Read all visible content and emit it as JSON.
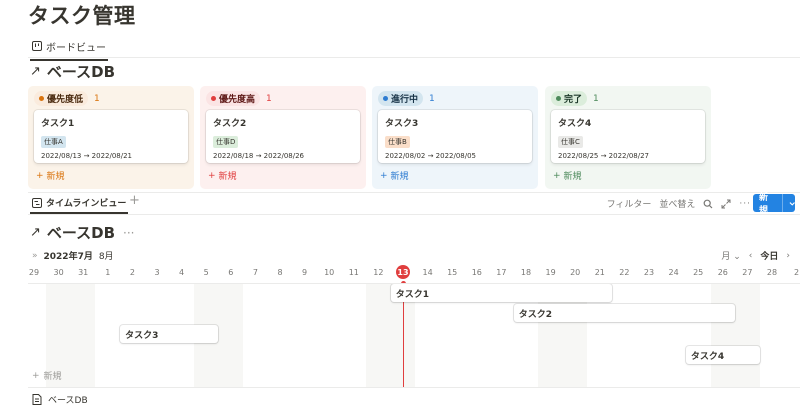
{
  "page_title": "タスク管理",
  "board_tab": {
    "label": "ボードビュー"
  },
  "board_db": {
    "title": "ベースDB"
  },
  "columns": [
    {
      "label": "優先度低",
      "count": "1",
      "dot": "#d9730d",
      "pill_bg": "#faebdd",
      "pill_text": "#49290e",
      "col_bg": "#fbf3e9",
      "new_color": "#d9730d",
      "new_label": "新規",
      "card": {
        "title": "タスク1",
        "tag": "仕事A",
        "tag_bg": "#d3e5ef",
        "date": "2022/08/13 → 2022/08/21"
      }
    },
    {
      "label": "優先度高",
      "count": "1",
      "dot": "#e03e3e",
      "pill_bg": "#fbe4e4",
      "pill_text": "#5d1715",
      "col_bg": "#fdf0ef",
      "new_color": "#e03e3e",
      "new_label": "新規",
      "card": {
        "title": "タスク2",
        "tag": "仕事D",
        "tag_bg": "#dbeddb",
        "date": "2022/08/18 → 2022/08/26"
      }
    },
    {
      "label": "進行中",
      "count": "1",
      "dot": "#2e7cd1",
      "pill_bg": "#d3e5ef",
      "pill_text": "#183347",
      "col_bg": "#eef5fa",
      "new_color": "#2e7cd1",
      "new_label": "新規",
      "card": {
        "title": "タスク3",
        "tag": "仕事B",
        "tag_bg": "#fadec9",
        "date": "2022/08/02 → 2022/08/05"
      }
    },
    {
      "label": "完了",
      "count": "1",
      "dot": "#4d8a5b",
      "pill_bg": "#dbeddb",
      "pill_text": "#1c3829",
      "col_bg": "#f2f7f2",
      "new_color": "#4d8a5b",
      "new_label": "新規",
      "card": {
        "title": "タスク4",
        "tag": "仕事C",
        "tag_bg": "#e9e9e7",
        "date": "2022/08/25 → 2022/08/27"
      }
    }
  ],
  "timeline_tab": {
    "label": "タイムラインビュー",
    "add": "+"
  },
  "toolbar": {
    "filter": "フィルター",
    "sort": "並べ替え",
    "new": "新規"
  },
  "timeline_db": {
    "title": "ベースDB",
    "more": "···"
  },
  "timeline_nav": {
    "collapse": "»",
    "year_month": "2022年7月",
    "next_month": "8月",
    "scale": "月",
    "today": "今日"
  },
  "days": [
    "29",
    "30",
    "31",
    "1",
    "2",
    "3",
    "4",
    "5",
    "6",
    "7",
    "8",
    "9",
    "10",
    "11",
    "12",
    "13",
    "14",
    "15",
    "16",
    "17",
    "18",
    "19",
    "20",
    "21",
    "22",
    "23",
    "24",
    "25",
    "26",
    "27",
    "28",
    "2"
  ],
  "today_day": "13",
  "bars": [
    {
      "label": "タスク1",
      "start": "2022/08/13",
      "end": "2022/08/21"
    },
    {
      "label": "タスク2",
      "start": "2022/08/18",
      "end": "2022/08/26"
    },
    {
      "label": "タスク3",
      "start": "2022/08/02",
      "end": "2022/08/05"
    },
    {
      "label": "タスク4",
      "start": "2022/08/25",
      "end": "2022/08/27"
    }
  ],
  "timeline_new": "新規",
  "footer": {
    "label": "ベースDB"
  }
}
